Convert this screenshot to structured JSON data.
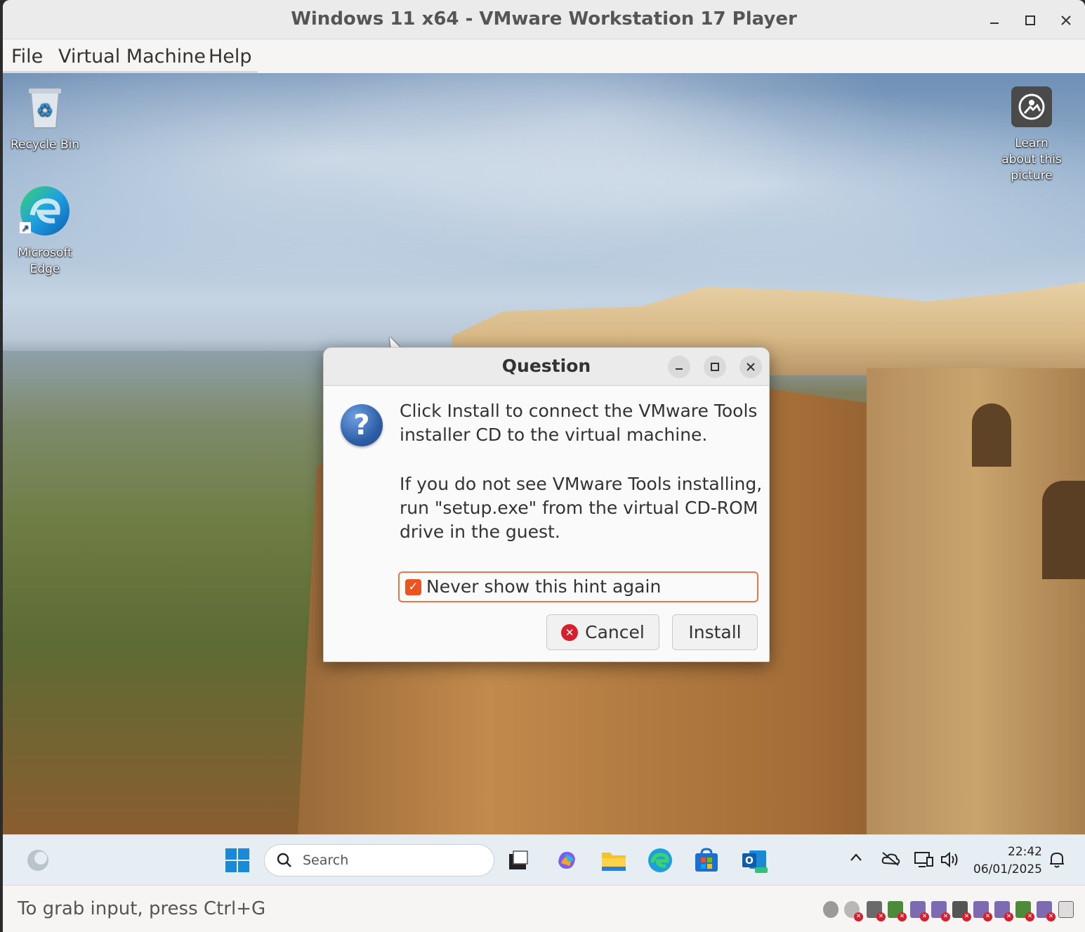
{
  "window": {
    "title": "Windows 11 x64 - VMware Workstation 17 Player",
    "minimize_label": "–",
    "maximize_label": "☐",
    "close_label": "✕"
  },
  "menubar": {
    "items": [
      "File",
      "Virtual Machine",
      "Help"
    ]
  },
  "desktop": {
    "icons": [
      {
        "label": "Recycle Bin",
        "icon": "recycle-bin-icon"
      },
      {
        "label": "Microsoft Edge",
        "icon": "edge-icon"
      },
      {
        "label": "Learn about this picture",
        "icon": "learn-picture-icon"
      }
    ]
  },
  "dialog": {
    "title": "Question",
    "message1": "Click Install to connect the VMware Tools installer CD to the virtual machine.",
    "message2": "If you do not see VMware Tools installing, run \"setup.exe\" from the virtual CD-ROM drive in the guest.",
    "checkbox_label": "Never show this hint again",
    "checkbox_checked": true,
    "cancel_label": "Cancel",
    "install_label": "Install",
    "accent_color": "#e95420"
  },
  "taskbar": {
    "search_placeholder": "Search",
    "apps": [
      "start-icon",
      "task-view-icon",
      "copilot-icon",
      "file-explorer-icon",
      "edge-icon",
      "store-icon",
      "outlook-icon"
    ],
    "tray": [
      "chevron-up-icon",
      "onedrive-icon",
      "network-icon",
      "volume-icon",
      "notification-icon"
    ],
    "time": "22:42",
    "date": "06/01/2025"
  },
  "statusbar": {
    "hint": "To grab input, press Ctrl+G"
  }
}
